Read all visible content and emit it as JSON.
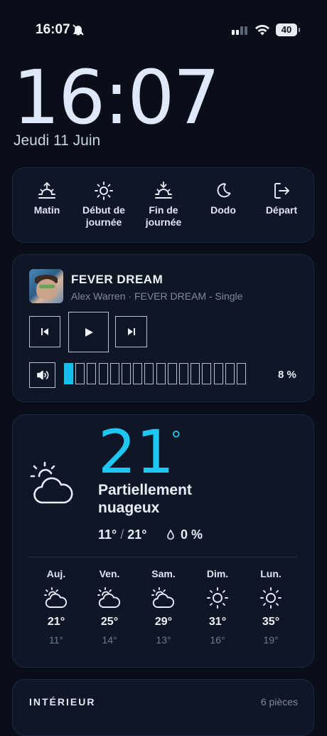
{
  "status_bar": {
    "time": "16:07",
    "battery": "40"
  },
  "lockscreen": {
    "clock": "16:07",
    "date": "Jeudi 11 Juin"
  },
  "scenes": [
    {
      "label": "Matin",
      "icon": "sunrise-icon"
    },
    {
      "label": "Début de journée",
      "icon": "sun-icon"
    },
    {
      "label": "Fin de journée",
      "icon": "sunset-icon"
    },
    {
      "label": "Dodo",
      "icon": "moon-icon"
    },
    {
      "label": "Départ",
      "icon": "exit-icon"
    }
  ],
  "media": {
    "title": "FEVER DREAM",
    "subtitle": "Alex Warren · FEVER DREAM - Single",
    "volume_percent": 8,
    "volume_label": "8 %",
    "volume_segments": 16,
    "volume_segments_on": 1
  },
  "weather": {
    "temperature": "21",
    "degree": "°",
    "condition": "Partiellement nuageux",
    "low": "11°",
    "separator": "/",
    "high": "21°",
    "precipitation": "0 %",
    "forecast": [
      {
        "day": "Auj.",
        "high": "21°",
        "low": "11°",
        "icon": "partly-cloudy-icon"
      },
      {
        "day": "Ven.",
        "high": "25°",
        "low": "14°",
        "icon": "partly-cloudy-icon"
      },
      {
        "day": "Sam.",
        "high": "29°",
        "low": "13°",
        "icon": "partly-cloudy-icon"
      },
      {
        "day": "Dim.",
        "high": "31°",
        "low": "16°",
        "icon": "sunny-icon"
      },
      {
        "day": "Lun.",
        "high": "35°",
        "low": "19°",
        "icon": "sunny-icon"
      }
    ]
  },
  "interior": {
    "title": "INTÉRIEUR",
    "count": "6 pièces"
  },
  "colors": {
    "background": "#0a0e18",
    "card": "#0f1626",
    "accent": "#1ec6f2",
    "text": "#e6edf8",
    "muted": "#7f8ba0"
  }
}
